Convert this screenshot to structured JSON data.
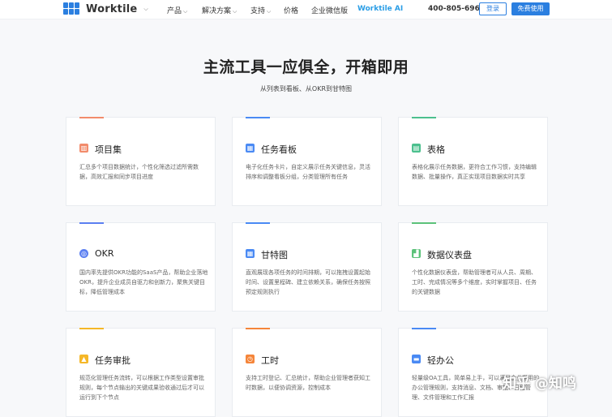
{
  "nav": {
    "logo_text": "Worktile",
    "logo_caret": "⌵",
    "menu": [
      {
        "label": "产品",
        "caret": "⌵"
      },
      {
        "label": "解决方案",
        "caret": "⌵"
      },
      {
        "label": "支持",
        "caret": "⌵"
      },
      {
        "label": "价格",
        "caret": ""
      },
      {
        "label": "企业微信版",
        "caret": ""
      },
      {
        "label": "Worktile AI",
        "caret": ""
      }
    ],
    "phone": "400-805-6966",
    "login_label": "登录",
    "free_label": "免费使用",
    "accent": "#2b7fe0"
  },
  "hero": {
    "title": "主流工具一应俱全，开箱即用",
    "subtitle": "从列表到看板、从OKR到甘特图"
  },
  "cards": [
    {
      "title": "项目集",
      "icon": "chart-icon",
      "glyph": "▥",
      "color": "#f28b6b",
      "desc": "汇总多个项目数据统计，个性化筛选过滤所需数据，高效汇报和同步项目进度"
    },
    {
      "title": "任务看板",
      "icon": "kanban-icon",
      "glyph": "▦",
      "color": "#4a8af4",
      "desc": "电子化任务卡片，自定义展示任务关键信息，灵活排序和调整看板分组，分类管理所有任务"
    },
    {
      "title": "表格",
      "icon": "table-icon",
      "glyph": "▤",
      "color": "#4cc08e",
      "desc": "表格化展示任务数据，更符合工作习惯，支持编辑数据、批量操作，真正实现项目数据实时共享"
    },
    {
      "title": "OKR",
      "icon": "target-icon",
      "glyph": "◎",
      "color": "#5b7ff1",
      "desc": "国内率先提供OKR功能的SaaS产品，帮助企业落地OKR，提升企业成员自驱力和创新力，聚焦关键目标，降低管理成本"
    },
    {
      "title": "甘特图",
      "icon": "gantt-icon",
      "glyph": "▦",
      "color": "#4a8af4",
      "desc": "直观展现各项任务的时间排期，可以拖拽设置起始时间、设置里程碑、建立依赖关系，确保任务按照预定规则执行"
    },
    {
      "title": "数据仪表盘",
      "icon": "dashboard-icon",
      "glyph": "▟",
      "color": "#5cc27a",
      "desc": "个性化数据仪表盘，帮助管理者可从人员、周期、工时、完成情况等多个维度，实时掌握项目、任务的关键数据"
    },
    {
      "title": "任务审批",
      "icon": "stamp-icon",
      "glyph": "▲",
      "color": "#f5b728",
      "desc": "规范化管理任务流转，可以根据工作类型设置审批规则，每个节点输出的关键成果验收通过后才可以运行到下个节点"
    },
    {
      "title": "工时",
      "icon": "clock-icon",
      "glyph": "◷",
      "color": "#f5853a",
      "desc": "支持工时登记、汇总统计，帮助企业管理者获知工时数据，以便协调资源，控制成本"
    },
    {
      "title": "轻办公",
      "icon": "folder-icon",
      "glyph": "▬",
      "color": "#4a8af4",
      "desc": "轻量级OA工具，简单易上手，可以满足企业常用的办公管理规则，支持消息、文档、审批、日程管理、文件管理和工作汇报"
    }
  ],
  "watermark": "知乎 @知鸣"
}
